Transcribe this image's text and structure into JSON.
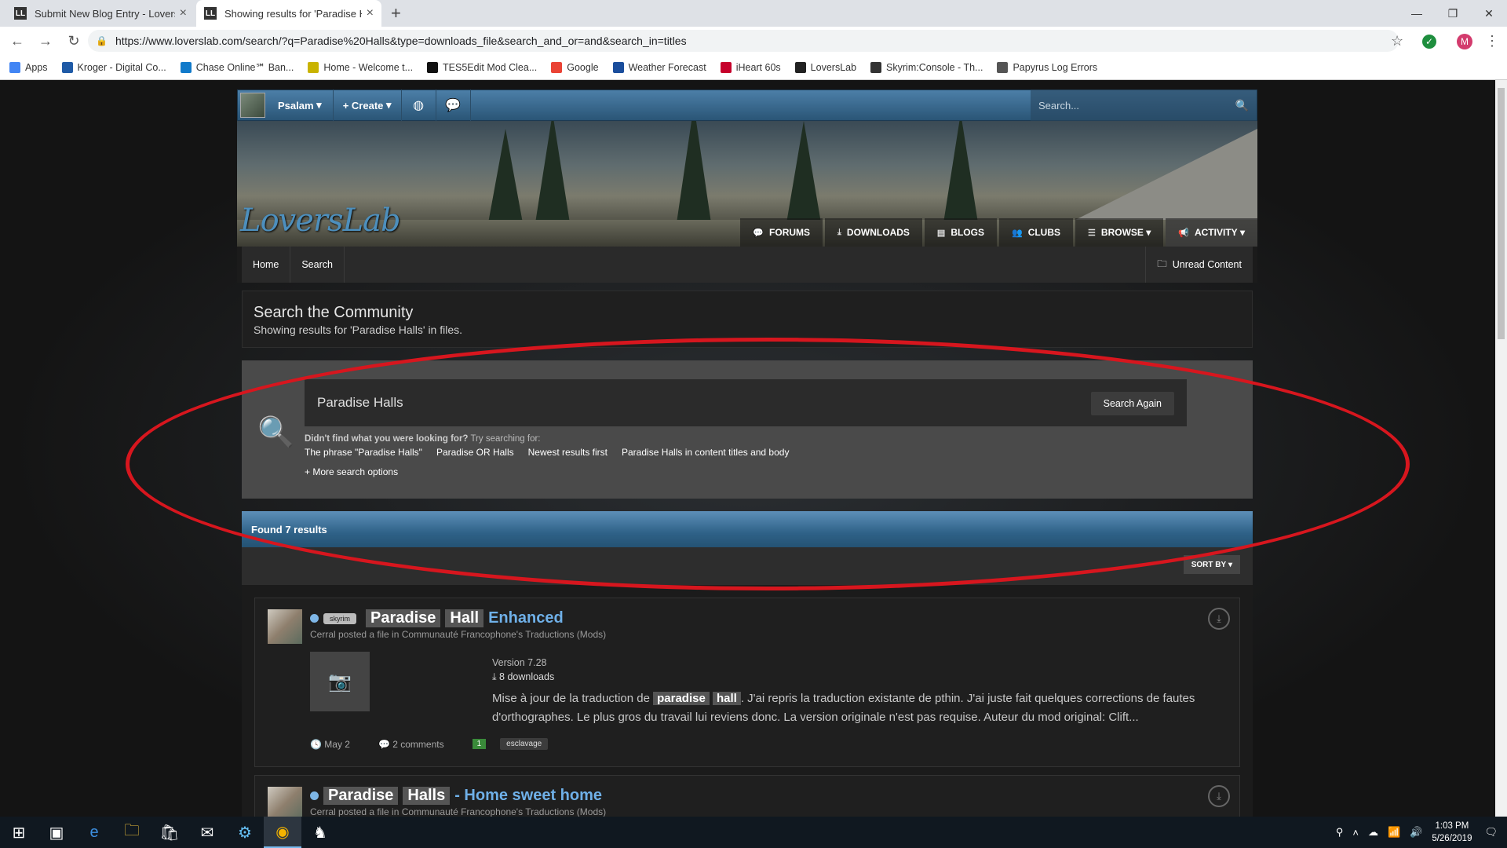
{
  "browser": {
    "tabs": [
      {
        "title": "Submit New Blog Entry - Loversl…",
        "favicon": "LL"
      },
      {
        "title": "Showing results for 'Paradise Hal…",
        "favicon": "LL"
      }
    ],
    "url": "https://www.loverslab.com/search/?q=Paradise%20Halls&type=downloads_file&search_and_or=and&search_in=titles",
    "profile_initial": "M",
    "bookmarks": [
      {
        "label": "Apps",
        "icon": "apps-grid-icon",
        "color": "#4285f4"
      },
      {
        "label": "Kroger - Digital Co...",
        "icon": "kroger-icon",
        "color": "#1f5aa6"
      },
      {
        "label": "Chase Online℠ Ban...",
        "icon": "chase-icon",
        "color": "#117aca"
      },
      {
        "label": "Home - Welcome t...",
        "icon": "home-icon",
        "color": "#c9b300"
      },
      {
        "label": "TES5Edit Mod Clea...",
        "icon": "tes5edit-icon",
        "color": "#111111"
      },
      {
        "label": "Google",
        "icon": "google-icon",
        "color": "#ea4335"
      },
      {
        "label": "Weather Forecast",
        "icon": "weather-icon",
        "color": "#1a4d9c"
      },
      {
        "label": "iHeart 60s",
        "icon": "iheart-icon",
        "color": "#c6002b"
      },
      {
        "label": "LoversLab",
        "icon": "loverslab-icon",
        "color": "#222222"
      },
      {
        "label": "Skyrim:Console - Th...",
        "icon": "skyrim-icon",
        "color": "#333333"
      },
      {
        "label": "Papyrus Log Errors",
        "icon": "papyrus-icon",
        "color": "#555555"
      }
    ]
  },
  "site": {
    "user": "Psalam",
    "create_label": "Create",
    "top_search_placeholder": "Search...",
    "logo": "LoversLab",
    "nav": [
      "FORUMS",
      "DOWNLOADS",
      "BLOGS",
      "CLUBS",
      "BROWSE",
      "ACTIVITY"
    ],
    "breadcrumbs": [
      "Home",
      "Search"
    ],
    "unread": "Unread Content",
    "page_title": "Search the Community",
    "page_subtitle": "Showing results for 'Paradise Halls' in files.",
    "search": {
      "value": "Paradise Halls",
      "button": "Search Again",
      "prompt_bold": "Didn't find what you were looking for?",
      "prompt_rest": "Try searching for:",
      "suggestions": [
        "The phrase \"Paradise Halls\"",
        "Paradise OR Halls",
        "Newest results first",
        "Paradise Halls in content titles and body"
      ],
      "more_options": "More search options"
    },
    "results_header": "Found 7 results",
    "sort_label": "SORT BY",
    "results": [
      {
        "tag": "skyrim",
        "title_hl_1": "Paradise",
        "title_hl_2": "Hall",
        "title_tail": "Enhanced",
        "byline": "Cerral posted a file in Communauté Francophone's Traductions (Mods)",
        "version": "Version 7.28",
        "downloads": "8 downloads",
        "snippet_pre": "Mise à jour de la traduction de",
        "snippet_hl_1": "paradise",
        "snippet_hl_2": "hall",
        "snippet_post": ". J'ai repris la traduction existante de pthin. J'ai juste fait quelques corrections de fautes d'orthographes. Le plus gros du travail lui reviens donc. La version originale n'est pas requise. Auteur du mod original: Clift...",
        "date": "May 2",
        "comments": "2 comments",
        "reputation": "1",
        "tag2": "esclavage"
      },
      {
        "title_hl_1": "Paradise",
        "title_hl_2": "Halls",
        "title_tail": "- Home sweet home",
        "byline": "Cerral posted a file in Communauté Francophone's Traductions (Mods)"
      }
    ]
  },
  "taskbar": {
    "time": "1:03 PM",
    "date": "5/26/2019"
  },
  "colors": {
    "annotation_ellipse": "#d7161e",
    "accent": "#2f6288"
  }
}
